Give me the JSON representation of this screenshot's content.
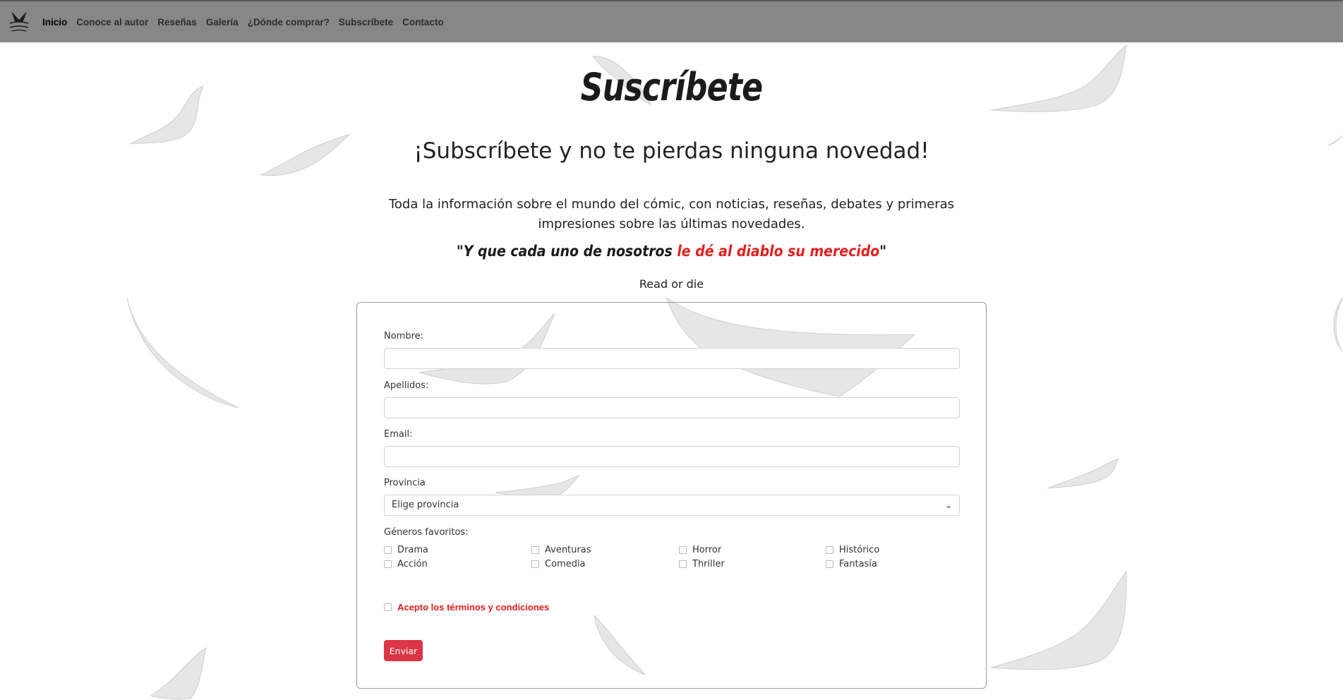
{
  "nav": {
    "items": [
      {
        "label": "Inicio",
        "active": true
      },
      {
        "label": "Conoce al autor"
      },
      {
        "label": "Reseñas"
      },
      {
        "label": "Galería"
      },
      {
        "label": "¿Dónde comprar?"
      },
      {
        "label": "Subscríbete"
      },
      {
        "label": "Contacto"
      }
    ]
  },
  "page": {
    "title": "Suscríbete",
    "subtitle": "¡Subscríbete y no te pierdas ninguna novedad!",
    "intro": "Toda la información sobre el mundo del cómic, con noticias, reseñas, debates y primeras impresiones sobre las últimas novedades.",
    "quote_start": "\"Y que cada uno de nosotros ",
    "quote_highlight": "le dé al diablo su merecido",
    "quote_end": "\"",
    "motto": "Read or die"
  },
  "form": {
    "nombre_label": "Nombre:",
    "apellidos_label": "Apellidos:",
    "email_label": "Email:",
    "provincia_label": "Provincia",
    "provincia_selected": "Elige provincia",
    "generos_label": "Géneros favoritos:",
    "generos": [
      "Drama",
      "Aventuras",
      "Horror",
      "Histórico",
      "Acción",
      "Comedia",
      "Thriller",
      "Fantasía"
    ],
    "terms_label": "Acepto los términos y condiciones",
    "submit_label": "Enviar"
  },
  "colors": {
    "navbar": "#878787",
    "accent_red": "#e02020",
    "button": "#dc3545"
  }
}
